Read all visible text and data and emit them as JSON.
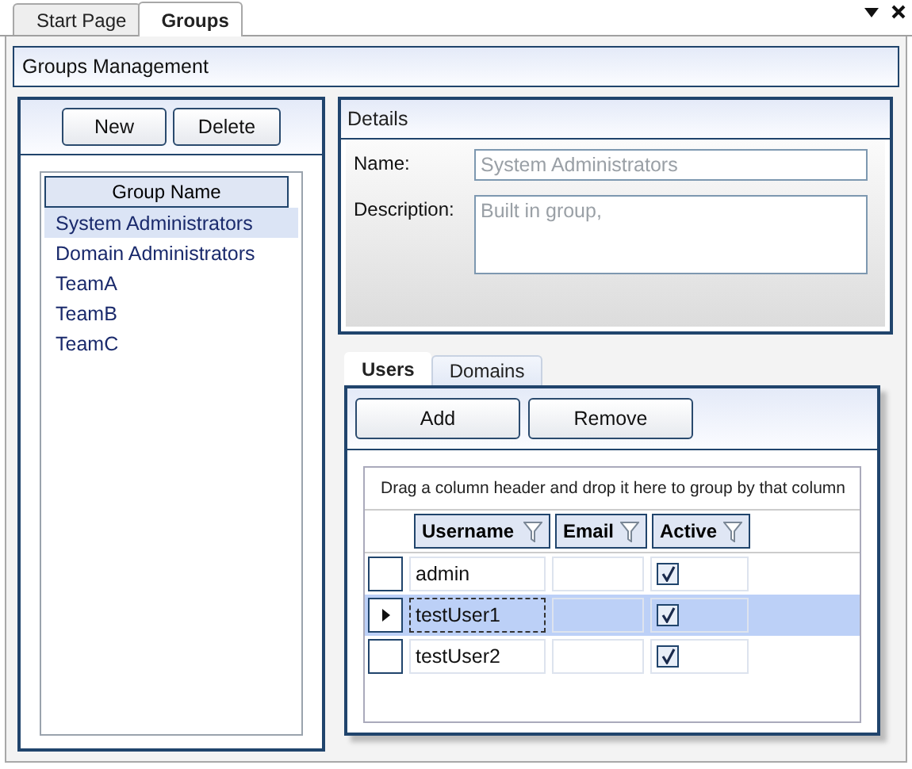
{
  "document_tabs": [
    {
      "label": "Start Page",
      "selected": false
    },
    {
      "label": "Groups",
      "selected": true
    }
  ],
  "header": {
    "title": "Groups Management"
  },
  "groups_panel": {
    "buttons": [
      "New",
      "Delete"
    ],
    "column": "Group Name",
    "items": [
      {
        "label": "System Administrators",
        "selected": true
      },
      {
        "label": "Domain Administrators",
        "selected": false
      },
      {
        "label": "TeamA",
        "selected": false
      },
      {
        "label": "TeamB",
        "selected": false
      },
      {
        "label": "TeamC",
        "selected": false
      }
    ]
  },
  "details": {
    "title": "Details",
    "disabled": true,
    "name_label": "Name:",
    "name_value": "System Administrators",
    "description_label": "Description:",
    "description_value": "Built in group,"
  },
  "detail_tabs": [
    {
      "label": "Users",
      "selected": true
    },
    {
      "label": "Domains",
      "selected": false
    }
  ],
  "users": {
    "buttons": [
      "Add",
      "Remove"
    ],
    "group_hint": "Drag a column header and drop it here to group by that column",
    "columns": [
      "Username",
      "Email",
      "Active"
    ],
    "rows": [
      {
        "username": "admin",
        "active": true,
        "selected": false
      },
      {
        "username": "testUser1",
        "active": true,
        "selected": true
      },
      {
        "username": "testUser2",
        "active": true,
        "selected": false
      }
    ]
  }
}
